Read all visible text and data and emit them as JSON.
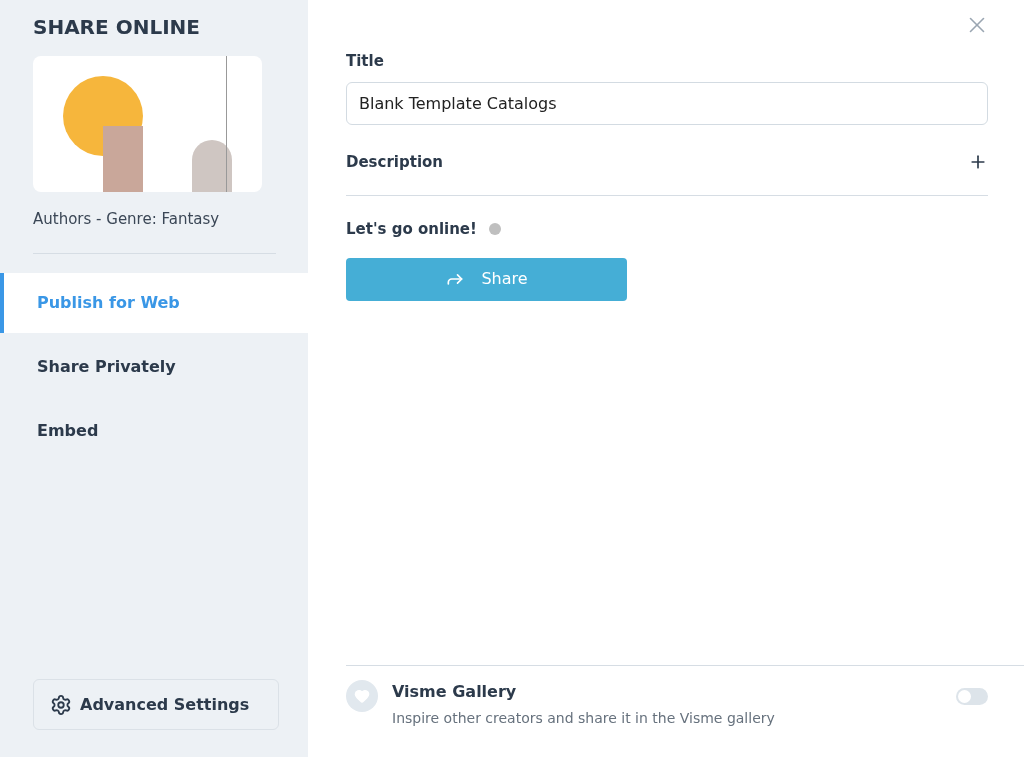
{
  "sidebar": {
    "heading": "SHARE ONLINE",
    "project_name": "Authors - Genre: Fantasy",
    "items": [
      {
        "label": "Publish for Web",
        "selected": true
      },
      {
        "label": "Share Privately",
        "selected": false
      },
      {
        "label": "Embed",
        "selected": false
      }
    ],
    "advanced_button": "Advanced Settings"
  },
  "form": {
    "title_label": "Title",
    "title_value": "Blank Template Catalogs",
    "description_label": "Description",
    "status_label": "Let's go online!",
    "online": false,
    "share_button": "Share"
  },
  "gallery": {
    "title": "Visme Gallery",
    "subtitle": "Inspire other creators and share it in the Visme gallery",
    "on": false
  }
}
